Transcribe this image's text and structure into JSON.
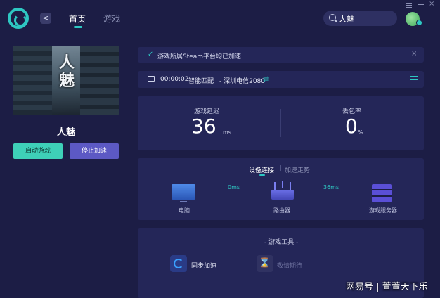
{
  "nav": {
    "back": "<",
    "tab_home": "首页",
    "tab_game": "游戏"
  },
  "search": {
    "value": "人魅"
  },
  "window": {
    "close": "×"
  },
  "game": {
    "cover_title": "人魅",
    "name": "人魅",
    "launch_label": "启动游戏",
    "stop_label": "停止加速"
  },
  "notice": {
    "text": "游戏所属Steam平台均已加速",
    "check": "✓",
    "close": "×"
  },
  "status": {
    "timer": "00:00:02",
    "mode": "智能匹配",
    "route": "- 深圳电信2080",
    "swap": "⇄"
  },
  "stats": {
    "latency_label": "游戏延迟",
    "latency_value": "36",
    "latency_unit": "ms",
    "loss_label": "丢包率",
    "loss_value": "0",
    "loss_unit": "%"
  },
  "network": {
    "tab_devices": "设备连接",
    "tab_trend": "加速走势",
    "separator": "|",
    "pc_label": "电脑",
    "router_label": "路由器",
    "server_label": "游戏服务器",
    "pc_router_ms": "0ms",
    "router_server_ms": "36ms"
  },
  "tools": {
    "title": "- 游戏工具 -",
    "sync_label": "同步加速",
    "wait_label": "敬请期待",
    "hourglass": "⌛"
  },
  "watermark": "网易号 | 萱萱天下乐",
  "colors": {
    "background": "#1c1d45",
    "panel": "#242658",
    "accent": "#2ec7c2",
    "stop_button": "#5c59c4",
    "launch_button": "#3ed0b8"
  }
}
